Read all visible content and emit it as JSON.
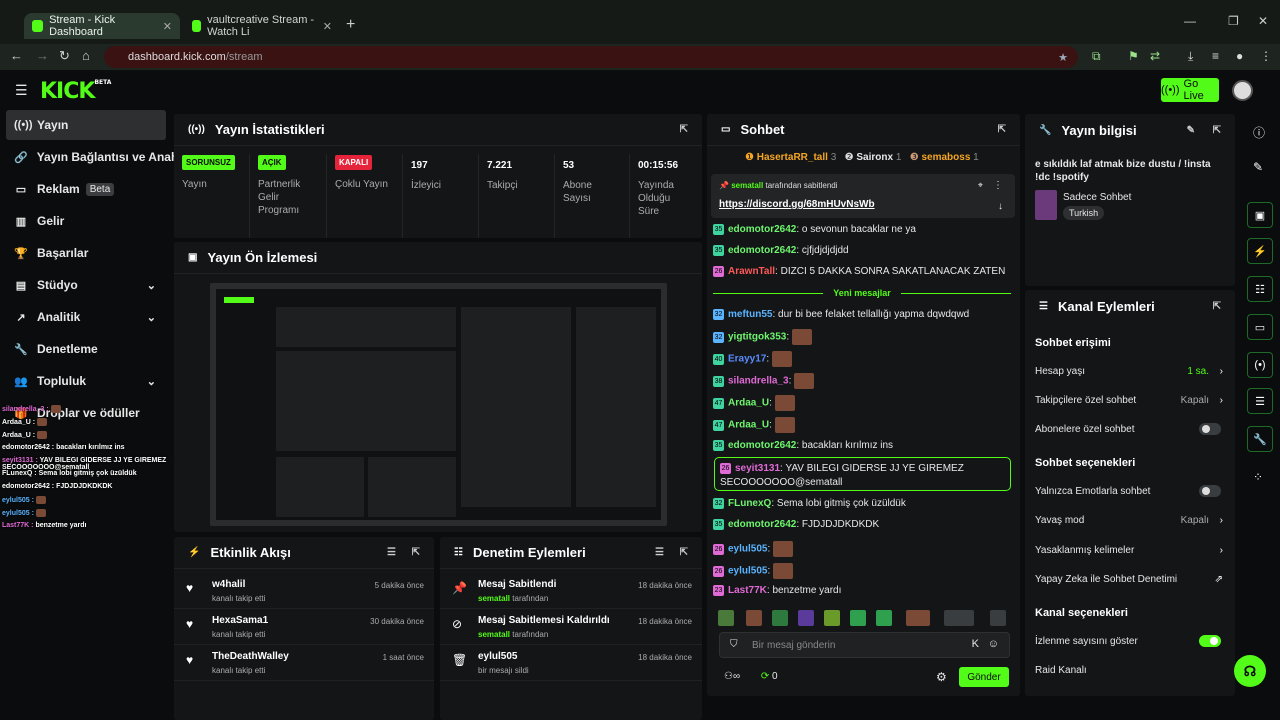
{
  "browser": {
    "tabs": [
      {
        "title": "Stream - Kick Dashboard"
      },
      {
        "title": "vaultcreative Stream - Watch Li"
      }
    ],
    "url_host": "dashboard.kick.com",
    "url_path": "/stream"
  },
  "header": {
    "logo": "KICK",
    "logo_sup": "BETA",
    "go_live": "Go Live"
  },
  "sidebar": {
    "items": [
      {
        "label": "Yayın"
      },
      {
        "label": "Yayın Bağlantısı ve Anahtar"
      },
      {
        "label": "Reklam",
        "badge": "Beta"
      },
      {
        "label": "Gelir"
      },
      {
        "label": "Başarılar"
      },
      {
        "label": "Stüdyo"
      },
      {
        "label": "Analitik"
      },
      {
        "label": "Denetleme"
      },
      {
        "label": "Topluluk"
      },
      {
        "label": "Droplar ve ödüller"
      }
    ]
  },
  "overlay_chat": [
    {
      "user": "silandrella_3 :"
    },
    {
      "user": "Ardaa_U :"
    },
    {
      "user": "Ardaa_U :"
    },
    {
      "user": "edomotor2642 :",
      "text": "bacakları kırılmız ins"
    },
    {
      "user": "seyit3131 :",
      "text": "YAV BILEGI GIDERSE JJ YE GIREMEZ SECOOOOOOO@sematall"
    },
    {
      "user": "FLunexQ :",
      "text": "Sema lobi gitmiş çok üzüldük"
    },
    {
      "user": "edomotor2642 :",
      "text": "FJDJDJDKDKDK"
    },
    {
      "user": "eylul505 :"
    },
    {
      "user": "eylul505 :"
    },
    {
      "user": "Last77K :",
      "text": "benzetme yardı"
    }
  ],
  "stats": {
    "title": "Yayın İstatistikleri",
    "items": [
      {
        "tag": "SORUNSUZ",
        "label": "Yayın"
      },
      {
        "tag": "AÇIK",
        "label": "Partnerlik Gelir Programı"
      },
      {
        "tag": "KAPALI",
        "label": "Çoklu Yayın"
      },
      {
        "value": "197",
        "label": "İzleyici"
      },
      {
        "value": "7.221",
        "label": "Takipçi"
      },
      {
        "value": "53",
        "label": "Abone Sayısı"
      },
      {
        "value": "00:15:56",
        "label": "Yayında Olduğu Süre"
      }
    ]
  },
  "preview": {
    "title": "Yayın Ön İzlemesi"
  },
  "activity": {
    "title": "Etkinlik Akışı",
    "items": [
      {
        "name": "w4halil",
        "sub": "kanalı takip etti",
        "time": "5 dakika önce"
      },
      {
        "name": "HexaSama1",
        "sub": "kanalı takip etti",
        "time": "30 dakika önce"
      },
      {
        "name": "TheDeathWalley",
        "sub": "kanalı takip etti",
        "time": "1 saat önce"
      }
    ]
  },
  "moderation": {
    "title": "Denetim Eylemleri",
    "items": [
      {
        "name": "Mesaj Sabitlendi",
        "by": "sematall",
        "sub": "tarafından",
        "time": "18 dakika önce"
      },
      {
        "name": "Mesaj Sabitlemesi Kaldırıldı",
        "by": "sematall",
        "sub": "tarafından",
        "time": "18 dakika önce"
      },
      {
        "name": "eylul505",
        "by": "",
        "sub": "bir mesajı sildi",
        "time": "18 dakika önce"
      }
    ]
  },
  "chat": {
    "title": "Sohbet",
    "leaders": [
      {
        "name": "HasertaRR_tall",
        "count": "3"
      },
      {
        "name": "Saironx",
        "count": "1"
      },
      {
        "name": "semaboss",
        "count": "1"
      }
    ],
    "pinned": {
      "by": "sematall",
      "suffix": "tarafından sabitlendi",
      "link": "https://discord.gg/68mHUvNsWb"
    },
    "new_messages": "Yeni mesajlar",
    "messages": [
      {
        "lvl": "35",
        "user": "edomotor2642",
        "text": "o sevonun bacaklar ne ya"
      },
      {
        "lvl": "35",
        "user": "edomotor2642",
        "text": "cjfjdjdjdjdd"
      },
      {
        "lvl": "26",
        "user": "ArawnTall",
        "text": "DIZCI 5 DAKKA SONRA SAKATLANACAK ZATEN"
      },
      {
        "lvl": "32",
        "user": "meftun55",
        "text": "dur bi bee felaket tellallığı yapma dqwdqwd"
      },
      {
        "lvl": "32",
        "user": "yigtitgok353",
        "text": ""
      },
      {
        "lvl": "40",
        "user": "Erayy17",
        "text": ""
      },
      {
        "lvl": "38",
        "user": "silandrella_3",
        "text": ""
      },
      {
        "lvl": "47",
        "user": "Ardaa_U",
        "text": ""
      },
      {
        "lvl": "47",
        "user": "Ardaa_U",
        "text": ""
      },
      {
        "lvl": "35",
        "user": "edomotor2642",
        "text": "bacakları kırılmız ins"
      },
      {
        "lvl": "26",
        "user": "seyit3131",
        "text": "YAV BILEGI GIDERSE JJ YE GIREMEZ SECOOOOOOO@sematall"
      },
      {
        "lvl": "32",
        "user": "FLunexQ",
        "text": "Sema lobi gitmiş çok üzüldük"
      },
      {
        "lvl": "35",
        "user": "edomotor2642",
        "text": "FJDJDJDKDKDK"
      },
      {
        "lvl": "26",
        "user": "eylul505",
        "text": ""
      },
      {
        "lvl": "26",
        "user": "eylul505",
        "text": ""
      },
      {
        "lvl": "23",
        "user": "Last77K",
        "text": "benzetme yardı"
      }
    ],
    "input_placeholder": "Bir mesaj gönderin",
    "points": "0",
    "send": "Gönder"
  },
  "stream_info": {
    "title": "Yayın bilgisi",
    "description": "e sıkıldık laf atmak bize dustu / !insta !dc !spotify",
    "category": "Sadece Sohbet",
    "language": "Turkish"
  },
  "channel_actions": {
    "title": "Kanal Eylemleri",
    "sections": [
      {
        "heading": "Sohbet erişimi"
      },
      {
        "heading": "Sohbet seçenekleri"
      },
      {
        "heading": "Kanal seçenekleri"
      }
    ],
    "rows": [
      {
        "label": "Hesap yaşı",
        "value": "1 sa."
      },
      {
        "label": "Takipçilere özel sohbet",
        "value": "Kapalı"
      },
      {
        "label": "Abonelere özel sohbet",
        "toggle": false
      },
      {
        "label": "Yalnızca Emotlarla sohbet",
        "toggle": false
      },
      {
        "label": "Yavaş mod",
        "value": "Kapalı"
      },
      {
        "label": "Yasaklanmış kelimeler"
      },
      {
        "label": "Yapay Zeka ile Sohbet Denetimi"
      },
      {
        "label": "İzlenme sayısını göster",
        "toggle": true
      },
      {
        "label": "Raid Kanalı"
      }
    ]
  },
  "colors": {
    "accent": "#53fc18",
    "panel": "#141517",
    "bg": "#0b0c0d"
  }
}
